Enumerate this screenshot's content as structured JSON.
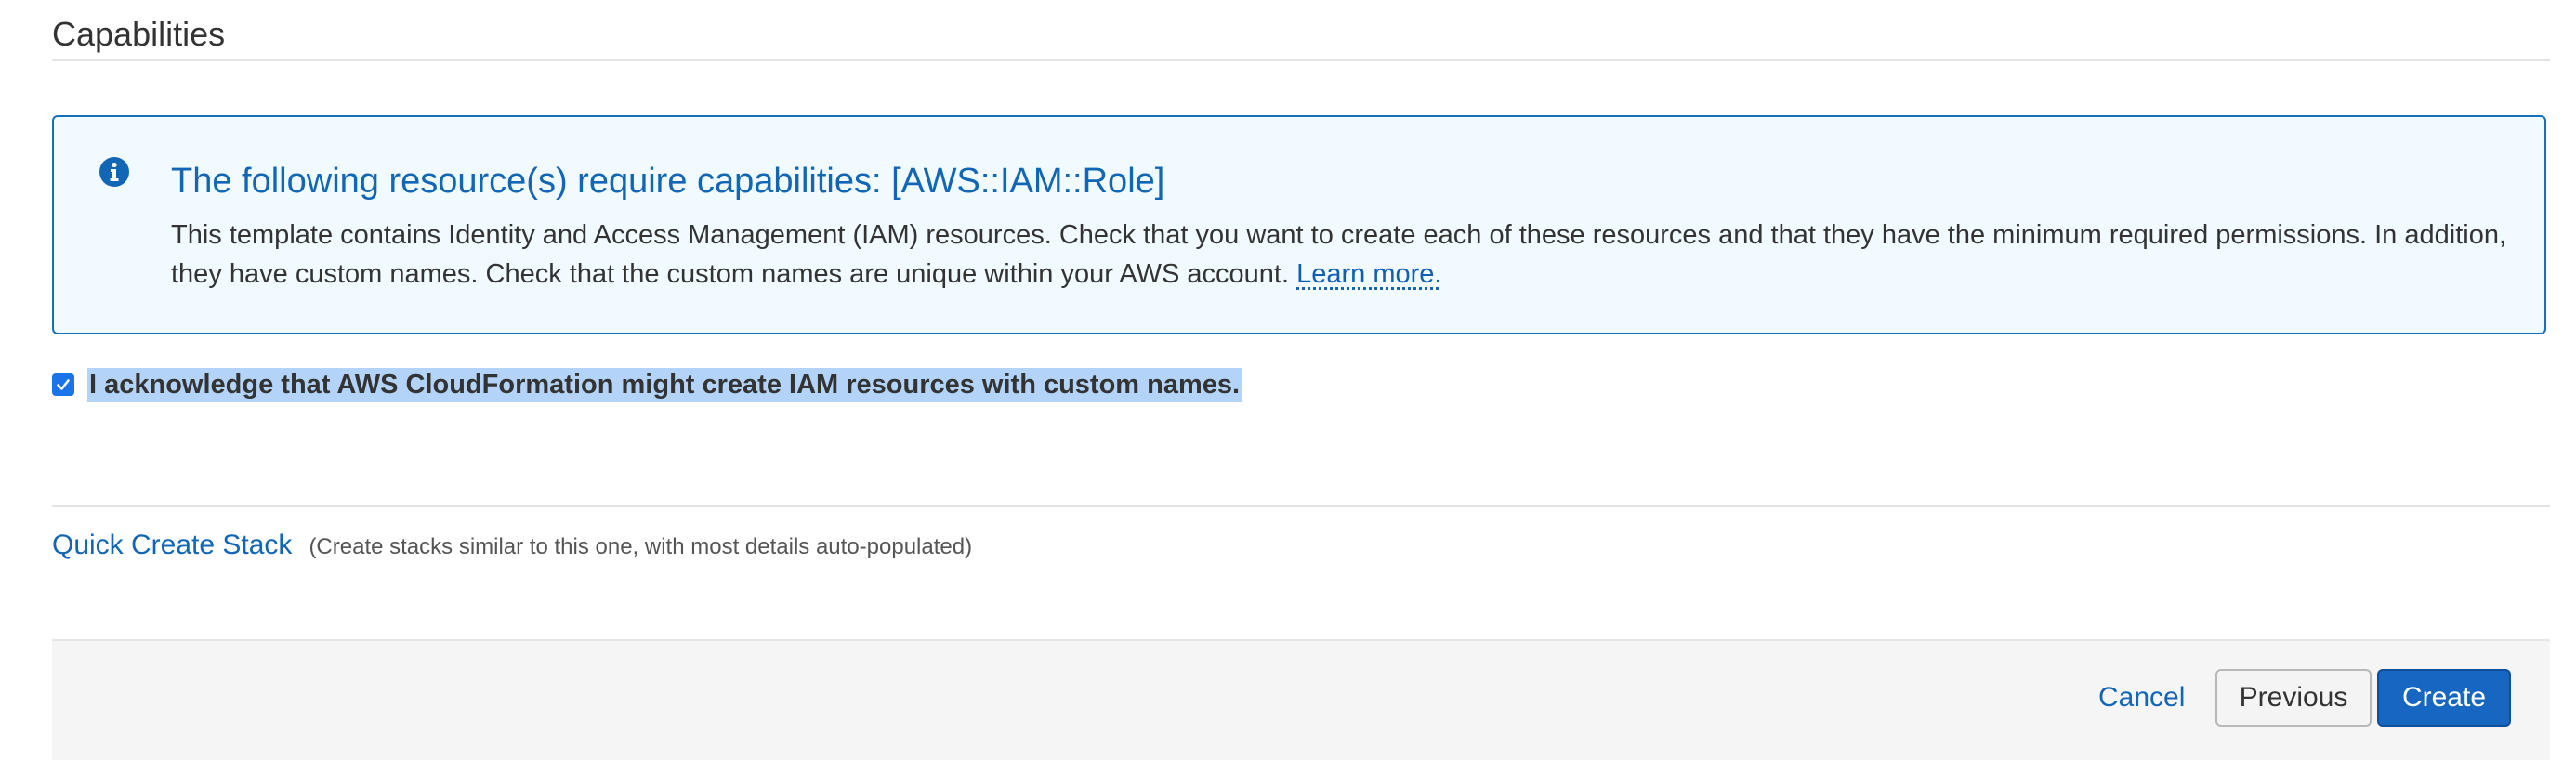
{
  "section": {
    "title": "Capabilities"
  },
  "info_box": {
    "icon": "info-icon",
    "title": "The following resource(s) require capabilities: [AWS::IAM::Role]",
    "body": "This template contains Identity and Access Management (IAM) resources. Check that you want to create each of these resources and that they have the minimum required permissions. In addition, they have custom names. Check that the custom names are unique within your AWS account. ",
    "link": "Learn more."
  },
  "acknowledge": {
    "checked": true,
    "label": "I acknowledge that AWS CloudFormation might create IAM resources with custom names."
  },
  "quick_create": {
    "link": "Quick Create Stack",
    "note": "(Create stacks similar to this one, with most details auto-populated)"
  },
  "footer": {
    "cancel": "Cancel",
    "previous": "Previous",
    "create": "Create"
  },
  "colors": {
    "accent": "#1266b6",
    "info_bg": "#f1faff",
    "info_border": "#1470b8",
    "primary_button": "#1766c2"
  }
}
